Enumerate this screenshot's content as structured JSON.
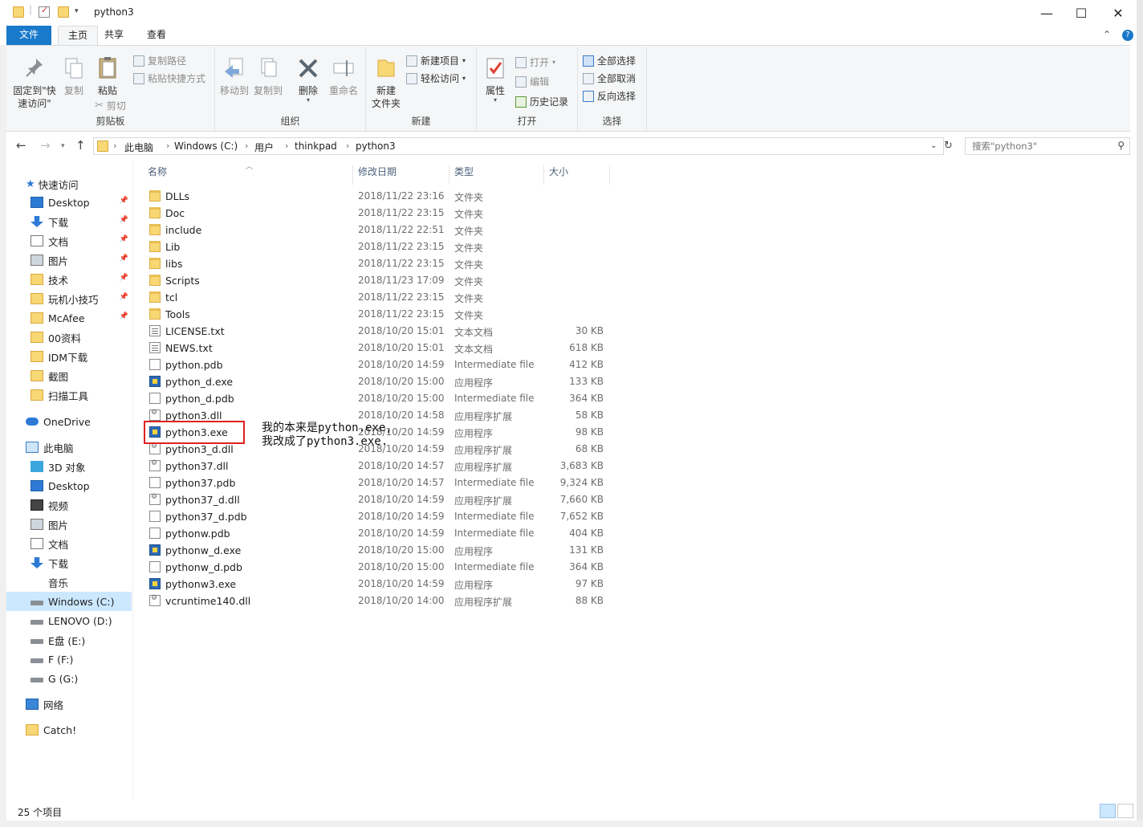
{
  "window": {
    "title": "python3",
    "minimize": "—",
    "maximize": "☐",
    "close": "✕"
  },
  "tabs": {
    "file": "文件",
    "home": "主页",
    "share": "共享",
    "view": "查看",
    "collapse": "⌃",
    "help": "?"
  },
  "ribbon": {
    "clipboard": {
      "label": "剪贴板",
      "pin_line1": "固定到\"快",
      "pin_line2": "速访问\"",
      "copy": "复制",
      "paste": "粘贴",
      "copy_path": "复制路径",
      "paste_shortcut": "粘贴快捷方式",
      "cut": "剪切"
    },
    "organize": {
      "label": "组织",
      "move_to": "移动到",
      "copy_to": "复制到",
      "delete": "删除",
      "rename": "重命名"
    },
    "new": {
      "label": "新建",
      "new_folder_line1": "新建",
      "new_folder_line2": "文件夹",
      "new_item": "新建项目",
      "easy_access": "轻松访问"
    },
    "open": {
      "label": "打开",
      "properties": "属性",
      "open": "打开",
      "edit": "编辑",
      "history": "历史记录"
    },
    "select": {
      "label": "选择",
      "select_all": "全部选择",
      "select_none": "全部取消",
      "invert": "反向选择"
    }
  },
  "address": {
    "crumbs": [
      "此电脑",
      "Windows (C:)",
      "用户",
      "thinkpad",
      "python3"
    ],
    "search_placeholder": "搜索\"python3\""
  },
  "nav": {
    "quick_access": "快速访问",
    "quick_items": [
      {
        "label": "Desktop",
        "pinned": true
      },
      {
        "label": "下载",
        "pinned": true
      },
      {
        "label": "文档",
        "pinned": true
      },
      {
        "label": "图片",
        "pinned": true
      },
      {
        "label": "技术",
        "pinned": true
      },
      {
        "label": "玩机小技巧",
        "pinned": true
      },
      {
        "label": "McAfee",
        "pinned": true
      },
      {
        "label": "00资料",
        "pinned": false
      },
      {
        "label": "IDM下载",
        "pinned": false
      },
      {
        "label": "截图",
        "pinned": false
      },
      {
        "label": "扫描工具",
        "pinned": false
      }
    ],
    "onedrive": "OneDrive",
    "this_pc": "此电脑",
    "pc_items": [
      "3D 对象",
      "Desktop",
      "视频",
      "图片",
      "文档",
      "下载",
      "音乐",
      "Windows (C:)",
      "LENOVO (D:)",
      "E盘 (E:)",
      "F (F:)",
      "G (G:)"
    ],
    "network": "网络",
    "catch": "Catch!"
  },
  "columns": {
    "name": "名称",
    "date": "修改日期",
    "type": "类型",
    "size": "大小"
  },
  "files": [
    {
      "name": "DLLs",
      "date": "2018/11/22 23:16",
      "type": "文件夹",
      "size": "",
      "icon": "folder"
    },
    {
      "name": "Doc",
      "date": "2018/11/22 23:15",
      "type": "文件夹",
      "size": "",
      "icon": "folder"
    },
    {
      "name": "include",
      "date": "2018/11/22 22:51",
      "type": "文件夹",
      "size": "",
      "icon": "folder"
    },
    {
      "name": "Lib",
      "date": "2018/11/22 23:15",
      "type": "文件夹",
      "size": "",
      "icon": "folder"
    },
    {
      "name": "libs",
      "date": "2018/11/22 23:15",
      "type": "文件夹",
      "size": "",
      "icon": "folder"
    },
    {
      "name": "Scripts",
      "date": "2018/11/23 17:09",
      "type": "文件夹",
      "size": "",
      "icon": "folder"
    },
    {
      "name": "tcl",
      "date": "2018/11/22 23:15",
      "type": "文件夹",
      "size": "",
      "icon": "folder"
    },
    {
      "name": "Tools",
      "date": "2018/11/22 23:15",
      "type": "文件夹",
      "size": "",
      "icon": "folder"
    },
    {
      "name": "LICENSE.txt",
      "date": "2018/10/20 15:01",
      "type": "文本文档",
      "size": "30 KB",
      "icon": "txt"
    },
    {
      "name": "NEWS.txt",
      "date": "2018/10/20 15:01",
      "type": "文本文档",
      "size": "618 KB",
      "icon": "txt"
    },
    {
      "name": "python.pdb",
      "date": "2018/10/20 14:59",
      "type": "Intermediate file",
      "size": "412 KB",
      "icon": "doc"
    },
    {
      "name": "python_d.exe",
      "date": "2018/10/20 15:00",
      "type": "应用程序",
      "size": "133 KB",
      "icon": "exe"
    },
    {
      "name": "python_d.pdb",
      "date": "2018/10/20 15:00",
      "type": "Intermediate file",
      "size": "364 KB",
      "icon": "doc"
    },
    {
      "name": "python3.dll",
      "date": "2018/10/20 14:58",
      "type": "应用程序扩展",
      "size": "58 KB",
      "icon": "dll"
    },
    {
      "name": "python3.exe",
      "date": "2018/10/20 14:59",
      "type": "应用程序",
      "size": "98 KB",
      "icon": "exe"
    },
    {
      "name": "python3_d.dll",
      "date": "2018/10/20 14:59",
      "type": "应用程序扩展",
      "size": "68 KB",
      "icon": "dll"
    },
    {
      "name": "python37.dll",
      "date": "2018/10/20 14:57",
      "type": "应用程序扩展",
      "size": "3,683 KB",
      "icon": "dll"
    },
    {
      "name": "python37.pdb",
      "date": "2018/10/20 14:57",
      "type": "Intermediate file",
      "size": "9,324 KB",
      "icon": "doc"
    },
    {
      "name": "python37_d.dll",
      "date": "2018/10/20 14:59",
      "type": "应用程序扩展",
      "size": "7,660 KB",
      "icon": "dll"
    },
    {
      "name": "python37_d.pdb",
      "date": "2018/10/20 14:59",
      "type": "Intermediate file",
      "size": "7,652 KB",
      "icon": "doc"
    },
    {
      "name": "pythonw.pdb",
      "date": "2018/10/20 14:59",
      "type": "Intermediate file",
      "size": "404 KB",
      "icon": "doc"
    },
    {
      "name": "pythonw_d.exe",
      "date": "2018/10/20 15:00",
      "type": "应用程序",
      "size": "131 KB",
      "icon": "exe"
    },
    {
      "name": "pythonw_d.pdb",
      "date": "2018/10/20 15:00",
      "type": "Intermediate file",
      "size": "364 KB",
      "icon": "doc"
    },
    {
      "name": "pythonw3.exe",
      "date": "2018/10/20 14:59",
      "type": "应用程序",
      "size": "97 KB",
      "icon": "exe"
    },
    {
      "name": "vcruntime140.dll",
      "date": "2018/10/20 14:00",
      "type": "应用程序扩展",
      "size": "88 KB",
      "icon": "dll"
    }
  ],
  "annotation": {
    "line1": "我的本来是python.exe,",
    "line2": "我改成了python3.exe."
  },
  "status": {
    "count": "25 个项目"
  },
  "colors": {
    "accent": "#1979ca",
    "selection": "#cce8ff",
    "highlight_box": "#e02020"
  }
}
